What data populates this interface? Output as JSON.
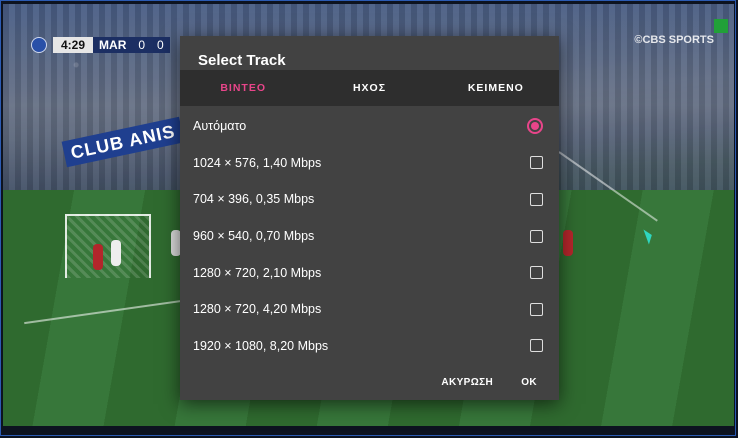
{
  "video": {
    "scorebug": {
      "time": "4:29",
      "team": "MAR",
      "score_left": "0",
      "score_right": "0"
    },
    "broadcaster": "©CBS SPORTS",
    "board_text": "CLUB ANIS",
    "accent_record": "#21a038"
  },
  "dialog": {
    "title": "Select Track",
    "tabs": [
      {
        "label": "ΒΙΝΤΕΟ",
        "active": true
      },
      {
        "label": "ΗΧΟΣ",
        "active": false
      },
      {
        "label": "ΚΕΙΜΕΝΟ",
        "active": false
      }
    ],
    "options": [
      {
        "label": "Αυτόματο",
        "control": "radio",
        "selected": true
      },
      {
        "label": "1024 × 576, 1,40 Mbps",
        "control": "checkbox",
        "selected": false
      },
      {
        "label": "704 × 396, 0,35 Mbps",
        "control": "checkbox",
        "selected": false
      },
      {
        "label": "960 × 540, 0,70 Mbps",
        "control": "checkbox",
        "selected": false
      },
      {
        "label": "1280 × 720, 2,10 Mbps",
        "control": "checkbox",
        "selected": false
      },
      {
        "label": "1280 × 720, 4,20 Mbps",
        "control": "checkbox",
        "selected": false
      },
      {
        "label": "1920 × 1080, 8,20 Mbps",
        "control": "checkbox",
        "selected": false
      }
    ],
    "actions": {
      "cancel": "ΑΚΥΡΩΣΗ",
      "ok": "OK"
    }
  },
  "colors": {
    "accent": "#e8458a",
    "dialog_bg": "#424242",
    "tab_bar_bg": "#2e2e2e"
  }
}
